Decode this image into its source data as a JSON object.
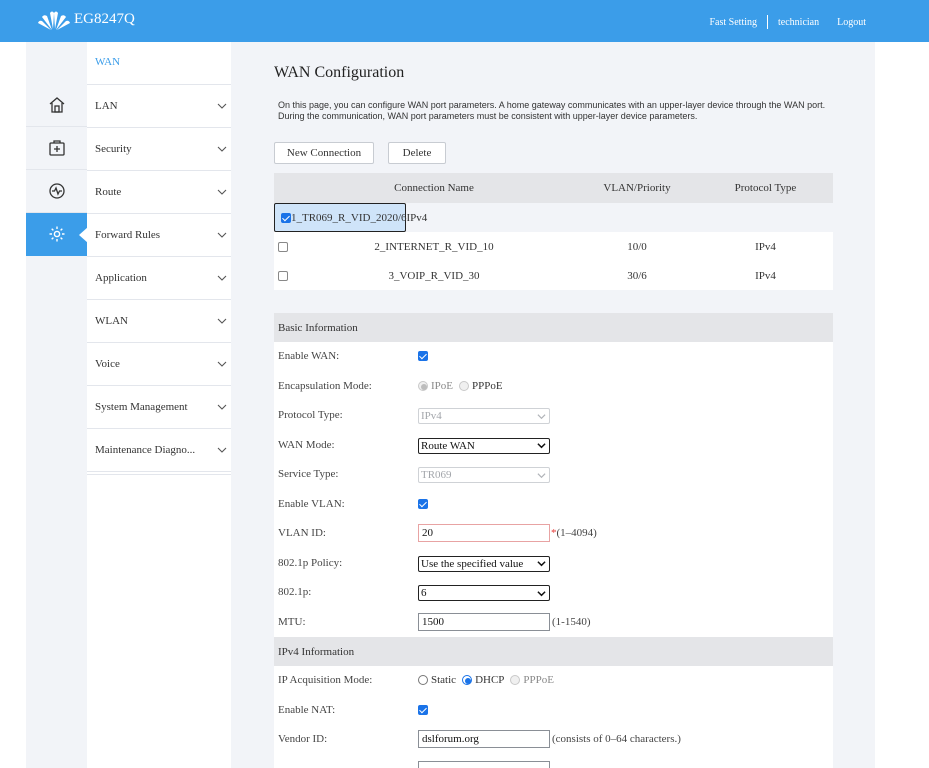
{
  "header": {
    "brand": "EG8247Q",
    "links": {
      "fast_setting": "Fast Setting",
      "user": "technician",
      "logout": "Logout"
    },
    "color": "#3b9de9"
  },
  "rail": {
    "items": [
      {
        "icon": "home-icon"
      },
      {
        "icon": "plus-box-icon"
      },
      {
        "icon": "pulse-icon"
      },
      {
        "icon": "gear-icon",
        "active": true
      }
    ]
  },
  "menu": {
    "current": "WAN",
    "items": [
      {
        "label": "LAN"
      },
      {
        "label": "Security"
      },
      {
        "label": "Route"
      },
      {
        "label": "Forward Rules"
      },
      {
        "label": "Application"
      },
      {
        "label": "WLAN"
      },
      {
        "label": "Voice"
      },
      {
        "label": "System Management"
      },
      {
        "label": "Maintenance Diagno..."
      }
    ]
  },
  "main": {
    "title": "WAN Configuration",
    "description": "On this page, you can configure WAN port parameters. A home gateway communicates with an upper-layer device through the WAN port. During the communication, WAN port parameters must be consistent with upper-layer device parameters.",
    "buttons": {
      "new": "New Connection",
      "delete": "Delete"
    },
    "table": {
      "headers": {
        "name": "Connection Name",
        "vlan": "VLAN/Priority",
        "protocol": "Protocol Type"
      },
      "rows": [
        {
          "checked": true,
          "name": "1_TR069_R_VID_20",
          "vlan": "20/6",
          "protocol": "IPv4"
        },
        {
          "checked": false,
          "name": "2_INTERNET_R_VID_10",
          "vlan": "10/0",
          "protocol": "IPv4"
        },
        {
          "checked": false,
          "name": "3_VOIP_R_VID_30",
          "vlan": "30/6",
          "protocol": "IPv4"
        }
      ]
    },
    "basic": {
      "title": "Basic Information",
      "enable_wan": {
        "label": "Enable WAN:",
        "checked": true
      },
      "encapsulation": {
        "label": "Encapsulation Mode:",
        "options": [
          "IPoE",
          "PPPoE"
        ],
        "selected": "IPoE"
      },
      "protocol_type": {
        "label": "Protocol Type:",
        "value": "IPv4"
      },
      "wan_mode": {
        "label": "WAN Mode:",
        "value": "Route WAN"
      },
      "service_type": {
        "label": "Service Type:",
        "value": "TR069"
      },
      "enable_vlan": {
        "label": "Enable VLAN:",
        "checked": true
      },
      "vlan_id": {
        "label": "VLAN ID:",
        "value": "20",
        "required": "*",
        "hint": "(1–4094)"
      },
      "policy": {
        "label": "802.1p Policy:",
        "value": "Use the specified value"
      },
      "p8021": {
        "label": "802.1p:",
        "value": "6"
      },
      "mtu": {
        "label": "MTU:",
        "value": "1500",
        "hint": "(1-1540)"
      }
    },
    "ipv4": {
      "title": "IPv4 Information",
      "acquisition": {
        "label": "IP Acquisition Mode:",
        "options": [
          "Static",
          "DHCP",
          "PPPoE"
        ],
        "selected": "DHCP"
      },
      "enable_nat": {
        "label": "Enable NAT:",
        "checked": true
      },
      "vendor_id": {
        "label": "Vendor ID:",
        "value": "dslforum.org",
        "hint": "(consists of 0–64 characters.)"
      }
    }
  }
}
